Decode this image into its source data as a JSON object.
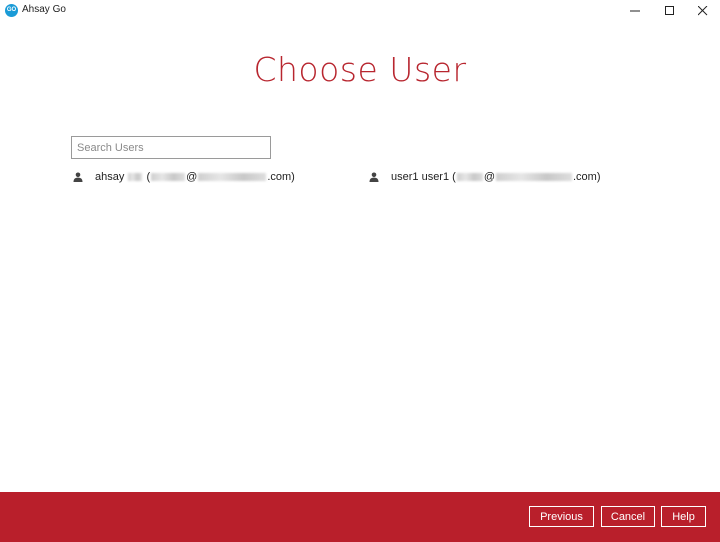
{
  "window": {
    "title": "Ahsay Go",
    "icon_text": "GO",
    "controls": [
      "minimize-icon",
      "maximize-icon",
      "close-icon"
    ]
  },
  "main": {
    "title": "Choose User",
    "search": {
      "placeholder": "Search Users",
      "value": ""
    },
    "users": [
      {
        "name_prefix": "ahsay",
        "email_visible_suffix": ".com)",
        "icon": "user-icon"
      },
      {
        "name_prefix": "user1 user1",
        "email_visible_suffix": ".com)",
        "icon": "user-icon"
      }
    ]
  },
  "footer": {
    "previous_label": "Previous",
    "cancel_label": "Cancel",
    "help_label": "Help"
  },
  "colors": {
    "accent": "#b91f2b",
    "title": "#b8262f"
  }
}
